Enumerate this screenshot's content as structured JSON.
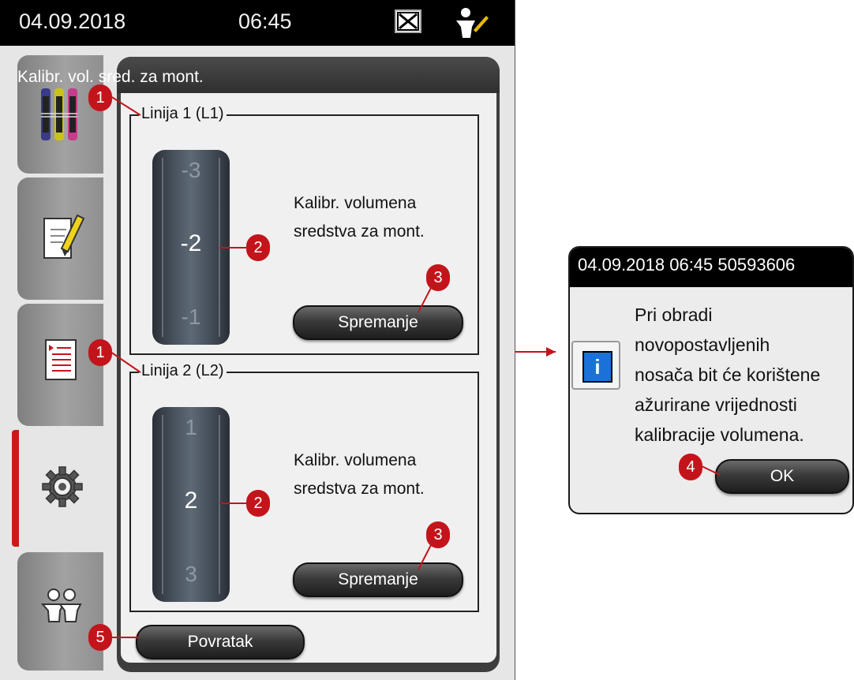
{
  "status_bar": {
    "date": "04.09.2018",
    "time": "06:45"
  },
  "panel": {
    "title": "Kalibr. vol. sred. za mont."
  },
  "lines": [
    {
      "label": "Linija 1 (L1)",
      "values": [
        "-3",
        "-2",
        "-1"
      ],
      "selected": "-2",
      "description_line1": "Kalibr. volumena",
      "description_line2": "sredstva za mont.",
      "save_label": "Spremanje"
    },
    {
      "label": "Linija 2 (L2)",
      "values": [
        "1",
        "2",
        "3"
      ],
      "selected": "2",
      "description_line1": "Kalibr. volumena",
      "description_line2": "sredstva za mont.",
      "save_label": "Spremanje"
    }
  ],
  "back_label": "Povratak",
  "dialog": {
    "title": "04.09.2018 06:45  50593606",
    "message_lines": [
      "Pri obradi",
      "novopostavljenih",
      "nosača bit će korištene",
      "ažurirane vrijednosti",
      "kalibracije volumena."
    ],
    "ok_label": "OK"
  },
  "callouts": [
    "1",
    "2",
    "3",
    "1",
    "2",
    "3",
    "4",
    "5"
  ],
  "colors": {
    "accent_red": "#c4141b",
    "active_tab_marker": "#cc1a1a",
    "info_blue": "#1a72d9"
  },
  "icons": [
    "reagent-rack-icon",
    "edit-program-icon",
    "protocol-list-icon",
    "settings-gear-icon",
    "user-icon",
    "error-status-icon",
    "info-icon"
  ]
}
